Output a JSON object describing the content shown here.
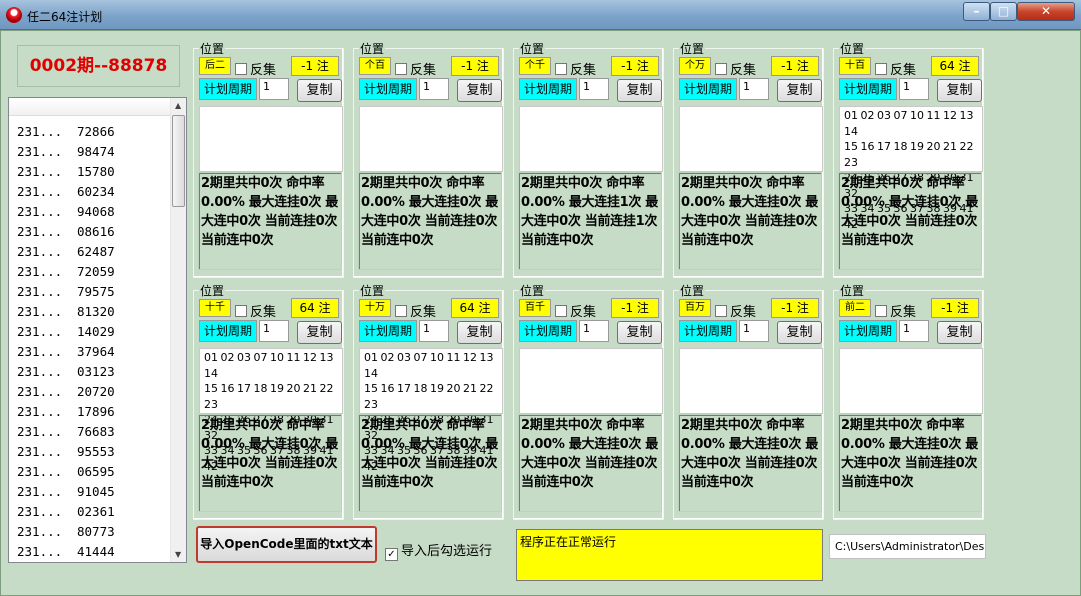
{
  "window": {
    "title": "任二64注计划",
    "minimize": "–",
    "maximize": "□",
    "close": "✕"
  },
  "period_display": "0002期--88878",
  "history": {
    "rows": [
      [
        "231...",
        "72866"
      ],
      [
        "231...",
        "98474"
      ],
      [
        "231...",
        "15780"
      ],
      [
        "231...",
        "60234"
      ],
      [
        "231...",
        "94068"
      ],
      [
        "231...",
        "08616"
      ],
      [
        "231...",
        "62487"
      ],
      [
        "231...",
        "72059"
      ],
      [
        "231...",
        "79575"
      ],
      [
        "231...",
        "81320"
      ],
      [
        "231...",
        "14029"
      ],
      [
        "231...",
        "37964"
      ],
      [
        "231...",
        "03123"
      ],
      [
        "231...",
        "20720"
      ],
      [
        "231...",
        "17896"
      ],
      [
        "231...",
        "76683"
      ],
      [
        "231...",
        "95553"
      ],
      [
        "231...",
        "06595"
      ],
      [
        "231...",
        "91045"
      ],
      [
        "231...",
        "02361"
      ],
      [
        "231...",
        "80773"
      ],
      [
        "231...",
        "41444"
      ]
    ]
  },
  "common": {
    "position_label": "位置",
    "reverse_label": "反集",
    "cycle_label": "计划周期",
    "cycle_value": "1",
    "copy_label": "复制"
  },
  "number_grid": "01 02 03 07 10 11 12 13 14\n15 16 17 18 19 20 21 22 23\n24 25 26 27 28 29 30 31 32\n33 34 35 36 37 38 39 41 42",
  "panels": [
    {
      "position": "后二",
      "zhu": "-1 注",
      "numbers": "",
      "stats": "2期里共中0次 命中率0.00% 最大连挂0次 最大连中0次 当前连挂0次 当前连中0次"
    },
    {
      "position": "个百",
      "zhu": "-1 注",
      "numbers": "",
      "stats": "2期里共中0次 命中率0.00% 最大连挂0次 最大连中0次 当前连挂0次 当前连中0次"
    },
    {
      "position": "个千",
      "zhu": "-1 注",
      "numbers": "",
      "stats": "2期里共中0次 命中率0.00% 最大连挂1次 最大连中0次 当前连挂1次 当前连中0次"
    },
    {
      "position": "个万",
      "zhu": "-1 注",
      "numbers": "",
      "stats": "2期里共中0次 命中率0.00% 最大连挂0次 最大连中0次 当前连挂0次 当前连中0次"
    },
    {
      "position": "十百",
      "zhu": "64 注",
      "numbers": "01 02 03 07 10 11 12 13 14\n15 16 17 18 19 20 21 22 23\n24 25 26 27 28 29 30 31 32\n33 34 35 36 37 38 39 41 42",
      "stats": "2期里共中0次 命中率0.00% 最大连挂0次 最大连中0次 当前连挂0次 当前连中0次"
    },
    {
      "position": "十千",
      "zhu": "64 注",
      "numbers": "01 02 03 07 10 11 12 13 14\n15 16 17 18 19 20 21 22 23\n24 25 26 27 28 29 30 31 32\n33 34 35 36 37 38 39 41 42",
      "stats": "2期里共中0次 命中率0.00% 最大连挂0次 最大连中0次 当前连挂0次 当前连中0次"
    },
    {
      "position": "十万",
      "zhu": "64 注",
      "numbers": "01 02 03 07 10 11 12 13 14\n15 16 17 18 19 20 21 22 23\n24 25 26 27 28 29 30 31 32\n33 34 35 36 37 38 39 41 42",
      "stats": "2期里共中0次 命中率0.00% 最大连挂0次 最大连中0次 当前连挂0次 当前连中0次"
    },
    {
      "position": "百千",
      "zhu": "-1 注",
      "numbers": "",
      "stats": "2期里共中0次 命中率0.00% 最大连挂0次 最大连中0次 当前连挂0次 当前连中0次"
    },
    {
      "position": "百万",
      "zhu": "-1 注",
      "numbers": "",
      "stats": "2期里共中0次 命中率0.00% 最大连挂0次 最大连中0次 当前连挂0次 当前连中0次"
    },
    {
      "position": "前二",
      "zhu": "-1 注",
      "numbers": "",
      "stats": "2期里共中0次 命中率0.00% 最大连挂0次 最大连中0次 当前连挂0次 当前连中0次"
    }
  ],
  "import_button": "导入OpenCode里面的txt文本",
  "auto_run": {
    "label": "导入后勾选运行",
    "checked": true
  },
  "status_text": "程序正在正常运行",
  "path_text": "C:\\Users\\Administrator\\Des",
  "colors": {
    "yellow": "#ffff00",
    "cyan": "#00ffff",
    "bg": "#c6dcc6",
    "period_red": "#e00000"
  }
}
